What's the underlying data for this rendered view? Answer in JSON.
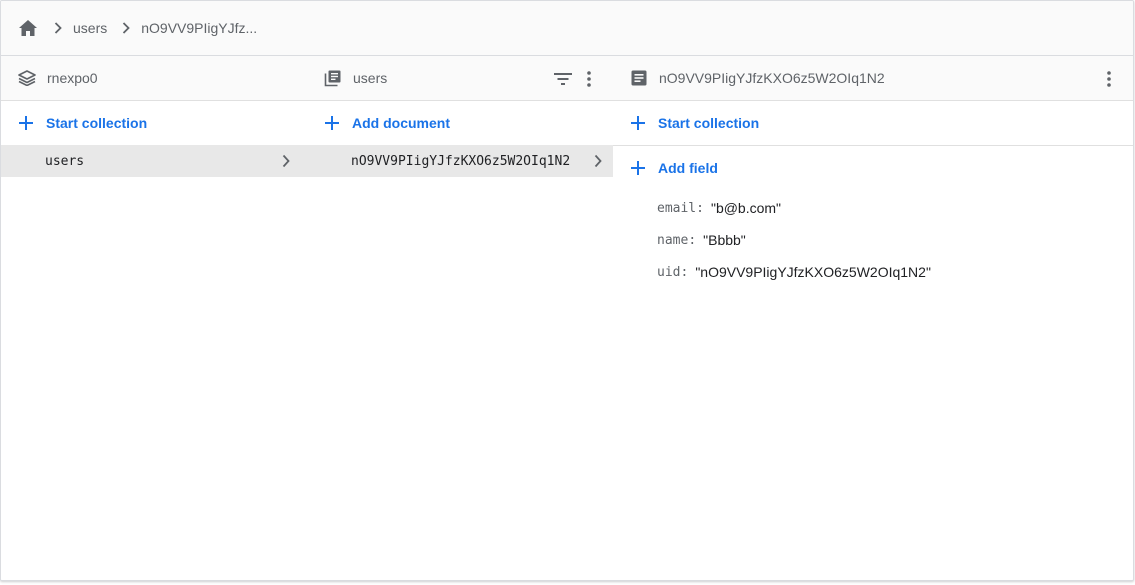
{
  "breadcrumb": {
    "home_icon": "home-icon",
    "items": [
      "users",
      "nO9VV9PIigYJfz..."
    ]
  },
  "panels": {
    "root": {
      "title": "rnexpo0",
      "icon": "database-icon",
      "action_label": "Start collection",
      "items": [
        {
          "label": "users",
          "selected": true
        }
      ]
    },
    "collection": {
      "title": "users",
      "icon": "collection-icon",
      "action_label": "Add document",
      "items": [
        {
          "label": "nO9VV9PIigYJfzKXO6z5W2OIq1N2",
          "selected": true
        }
      ]
    },
    "document": {
      "title": "nO9VV9PIigYJfzKXO6z5W2OIq1N2",
      "icon": "document-icon",
      "action_label": "Start collection",
      "add_field_label": "Add field",
      "fields": [
        {
          "key": "email",
          "value": "\"b@b.com\""
        },
        {
          "key": "name",
          "value": "\"Bbbb\""
        },
        {
          "key": "uid",
          "value": "\"nO9VV9PIigYJfzKXO6z5W2OIq1N2\""
        }
      ]
    }
  },
  "colors": {
    "accent": "#1a73e8",
    "icon": "#5f6368",
    "selected_bg": "#e8e8e8"
  }
}
